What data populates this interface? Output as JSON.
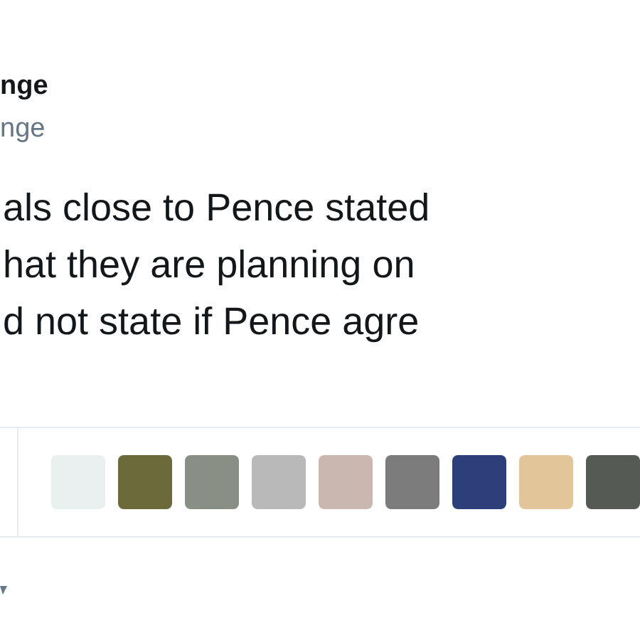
{
  "tweet": {
    "author_name": "nge",
    "author_handle": "nge",
    "text_lines": [
      "als close to Pence stated",
      "hat they are planning on",
      "d not state if Pence agre"
    ]
  }
}
